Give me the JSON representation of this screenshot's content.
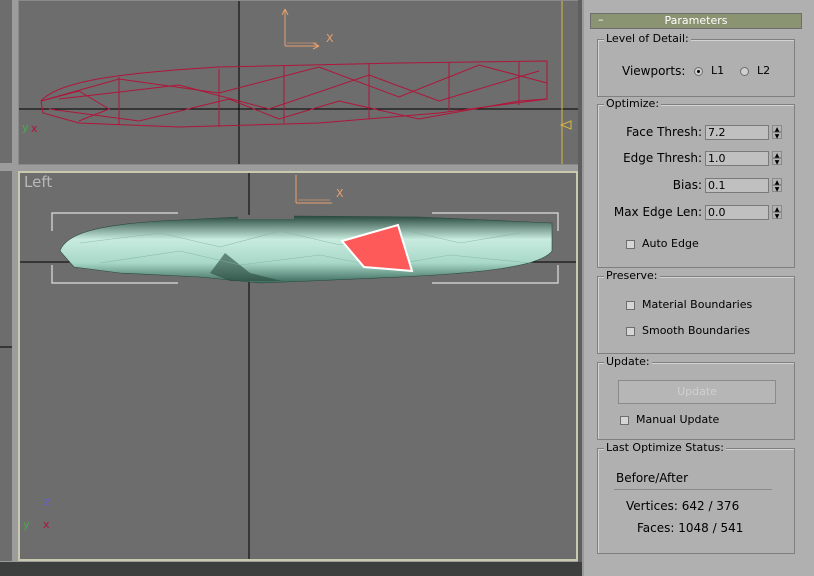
{
  "viewports": {
    "top": {
      "axis_x": "X",
      "axis_y": "y",
      "axis_x_small": "x"
    },
    "left": {
      "label": "Left",
      "axis_x": "X",
      "axis_y": "y",
      "axis_z": "z",
      "axis_x_small": "x"
    }
  },
  "panel": {
    "rollout": {
      "minus": "–",
      "title": "Parameters"
    },
    "level_of_detail": {
      "title": "Level of Detail:",
      "viewports_label": "Viewports:",
      "option_l1": "L1",
      "option_l2": "L2",
      "selected": "L1"
    },
    "optimize": {
      "title": "Optimize:",
      "face_thresh_label": "Face Thresh:",
      "face_thresh_value": "7.2",
      "edge_thresh_label": "Edge Thresh:",
      "edge_thresh_value": "1.0",
      "bias_label": "Bias:",
      "bias_value": "0.1",
      "max_edge_label": "Max Edge Len:",
      "max_edge_value": "0.0",
      "auto_edge_label": "Auto Edge"
    },
    "preserve": {
      "title": "Preserve:",
      "material_label": "Material Boundaries",
      "smooth_label": "Smooth Boundaries"
    },
    "update": {
      "title": "Update:",
      "button_label": "Update",
      "manual_label": "Manual Update"
    },
    "status": {
      "title": "Last Optimize Status:",
      "before_after": "Before/After",
      "vertices": "Vertices: 642 / 376",
      "faces": "Faces: 1048 / 541"
    }
  },
  "colors": {
    "wire": "#b0153a",
    "mesh": "#9fd4c4",
    "selected_face": "#ff5a5a",
    "axis_x": "#e8a070",
    "axis_y": "#4caa4c",
    "axis_z": "#6060e0"
  }
}
